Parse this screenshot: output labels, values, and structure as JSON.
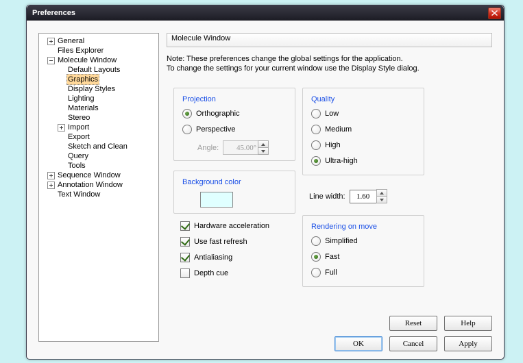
{
  "window": {
    "title": "Preferences"
  },
  "tree": {
    "general": "General",
    "filesExplorer": "Files Explorer",
    "moleculeWindow": "Molecule Window",
    "defaultLayouts": "Default Layouts",
    "graphics": "Graphics",
    "displayStyles": "Display Styles",
    "lighting": "Lighting",
    "materials": "Materials",
    "stereo": "Stereo",
    "import": "Import",
    "export": "Export",
    "sketchClean": "Sketch and Clean",
    "query": "Query",
    "tools": "Tools",
    "sequenceWindow": "Sequence Window",
    "annotationWindow": "Annotation Window",
    "textWindow": "Text Window"
  },
  "header": "Molecule Window",
  "note": {
    "l1": "Note: These preferences change the global settings for the application.",
    "l2": "To change the settings for your current window use the Display Style dialog."
  },
  "groups": {
    "projection": "Projection",
    "quality": "Quality",
    "bgcolor": "Background color",
    "rom": "Rendering on move"
  },
  "projection": {
    "ortho": "Orthographic",
    "persp": "Perspective",
    "angleLabel": "Angle:",
    "angleValue": "45.00°"
  },
  "quality": {
    "low": "Low",
    "medium": "Medium",
    "high": "High",
    "ultra": "Ultra-high"
  },
  "bgcolor": "#E0FFFF",
  "checks": {
    "hw": "Hardware acceleration",
    "ufr": "Use fast refresh",
    "aa": "Antialiasing",
    "dc": "Depth cue"
  },
  "linewidth": {
    "label": "Line width:",
    "value": "1.60"
  },
  "rom": {
    "simplified": "Simplified",
    "fast": "Fast",
    "full": "Full"
  },
  "buttons": {
    "reset": "Reset",
    "help": "Help",
    "ok": "OK",
    "cancel": "Cancel",
    "apply": "Apply"
  }
}
